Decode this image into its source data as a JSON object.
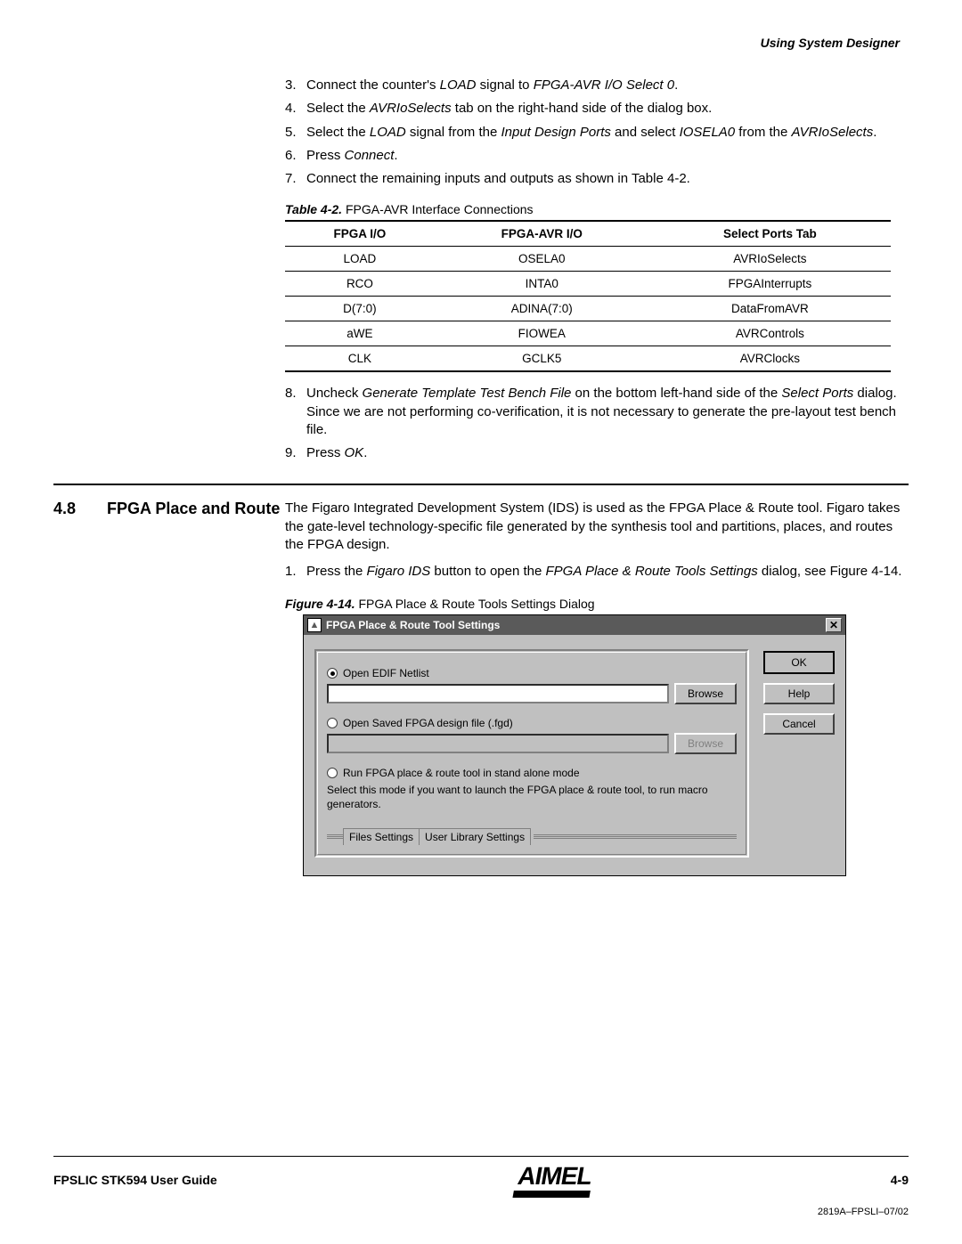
{
  "header": {
    "running": "Using System Designer"
  },
  "steps_top": [
    {
      "n": "3.",
      "pre": "Connect the counter's ",
      "i1": "LOAD",
      "mid": " signal to ",
      "i2": "FPGA-AVR I/O Select 0",
      "post": "."
    },
    {
      "n": "4.",
      "pre": "Select the ",
      "i1": "AVRIoSelects",
      "mid": " tab on the right-hand side of the dialog box.",
      "i2": "",
      "post": ""
    },
    {
      "n": "5.",
      "pre": "Select the ",
      "i1": "LOAD",
      "mid": " signal from the ",
      "i2": "Input Design Ports",
      "post": " and select ",
      "i3": "IOSELA0",
      "post2": " from the ",
      "i4": "AVRIoSelects",
      "post3": "."
    },
    {
      "n": "6.",
      "pre": "Press ",
      "i1": "Connect",
      "mid": ".",
      "i2": "",
      "post": ""
    },
    {
      "n": "7.",
      "pre": "Connect the remaining inputs and outputs as shown in Table 4-2.",
      "i1": "",
      "mid": "",
      "i2": "",
      "post": ""
    }
  ],
  "table": {
    "caption_bold": "Table 4-2.",
    "caption_rest": "  FPGA-AVR Interface Connections",
    "headers": [
      "FPGA I/O",
      "FPGA-AVR I/O",
      "Select Ports Tab"
    ],
    "rows": [
      [
        "LOAD",
        "OSELA0",
        "AVRIoSelects"
      ],
      [
        "RCO",
        "INTA0",
        "FPGAInterrupts"
      ],
      [
        "D(7:0)",
        "ADINA(7:0)",
        "DataFromAVR"
      ],
      [
        "aWE",
        "FIOWEA",
        "AVRControls"
      ],
      [
        "CLK",
        "GCLK5",
        "AVRClocks"
      ]
    ]
  },
  "steps_mid": [
    {
      "n": "8.",
      "pre": "Uncheck ",
      "i1": "Generate Template Test Bench File",
      "mid": " on the bottom left-hand side of the ",
      "i2": "Select Ports",
      "post": " dialog. Since we are not performing co-verification, it is not necessary to generate the pre-layout test bench file."
    },
    {
      "n": "9.",
      "pre": "Press ",
      "i1": "OK",
      "mid": ".",
      "i2": "",
      "post": ""
    }
  ],
  "section": {
    "num": "4.8",
    "title": "FPGA Place and Route",
    "intro": "The Figaro Integrated Development System (IDS) is used as the FPGA Place & Route tool. Figaro takes the gate-level technology-specific file generated by the synthesis tool and partitions, places, and routes the FPGA design.",
    "step1_n": "1.",
    "step1_pre": "Press the ",
    "step1_i1": "Figaro IDS",
    "step1_mid": " button to open the ",
    "step1_i2": "FPGA Place & Route Tools Settings",
    "step1_post": " dialog, see Figure 4-14."
  },
  "figure": {
    "caption_bold": "Figure 4-14.",
    "caption_rest": "  FPGA Place & Route Tools Settings Dialog"
  },
  "dialog": {
    "title": "FPGA Place & Route Tool Settings",
    "radio1": "Open EDIF Netlist",
    "browse1": "Browse",
    "radio2": "Open Saved FPGA design file (.fgd)",
    "browse2": "Browse",
    "radio3": "Run FPGA place & route tool in stand alone mode",
    "desc": "Select this mode if you want to launch the FPGA place & route tool, to run macro generators.",
    "tab1": "Files Settings",
    "tab2": "User Library Settings",
    "ok": "OK",
    "help": "Help",
    "cancel": "Cancel"
  },
  "footer": {
    "left": "FPSLIC STK594 User Guide",
    "logo": "AIMEL",
    "right": "4-9",
    "docid": "2819A–FPSLI–07/02"
  }
}
